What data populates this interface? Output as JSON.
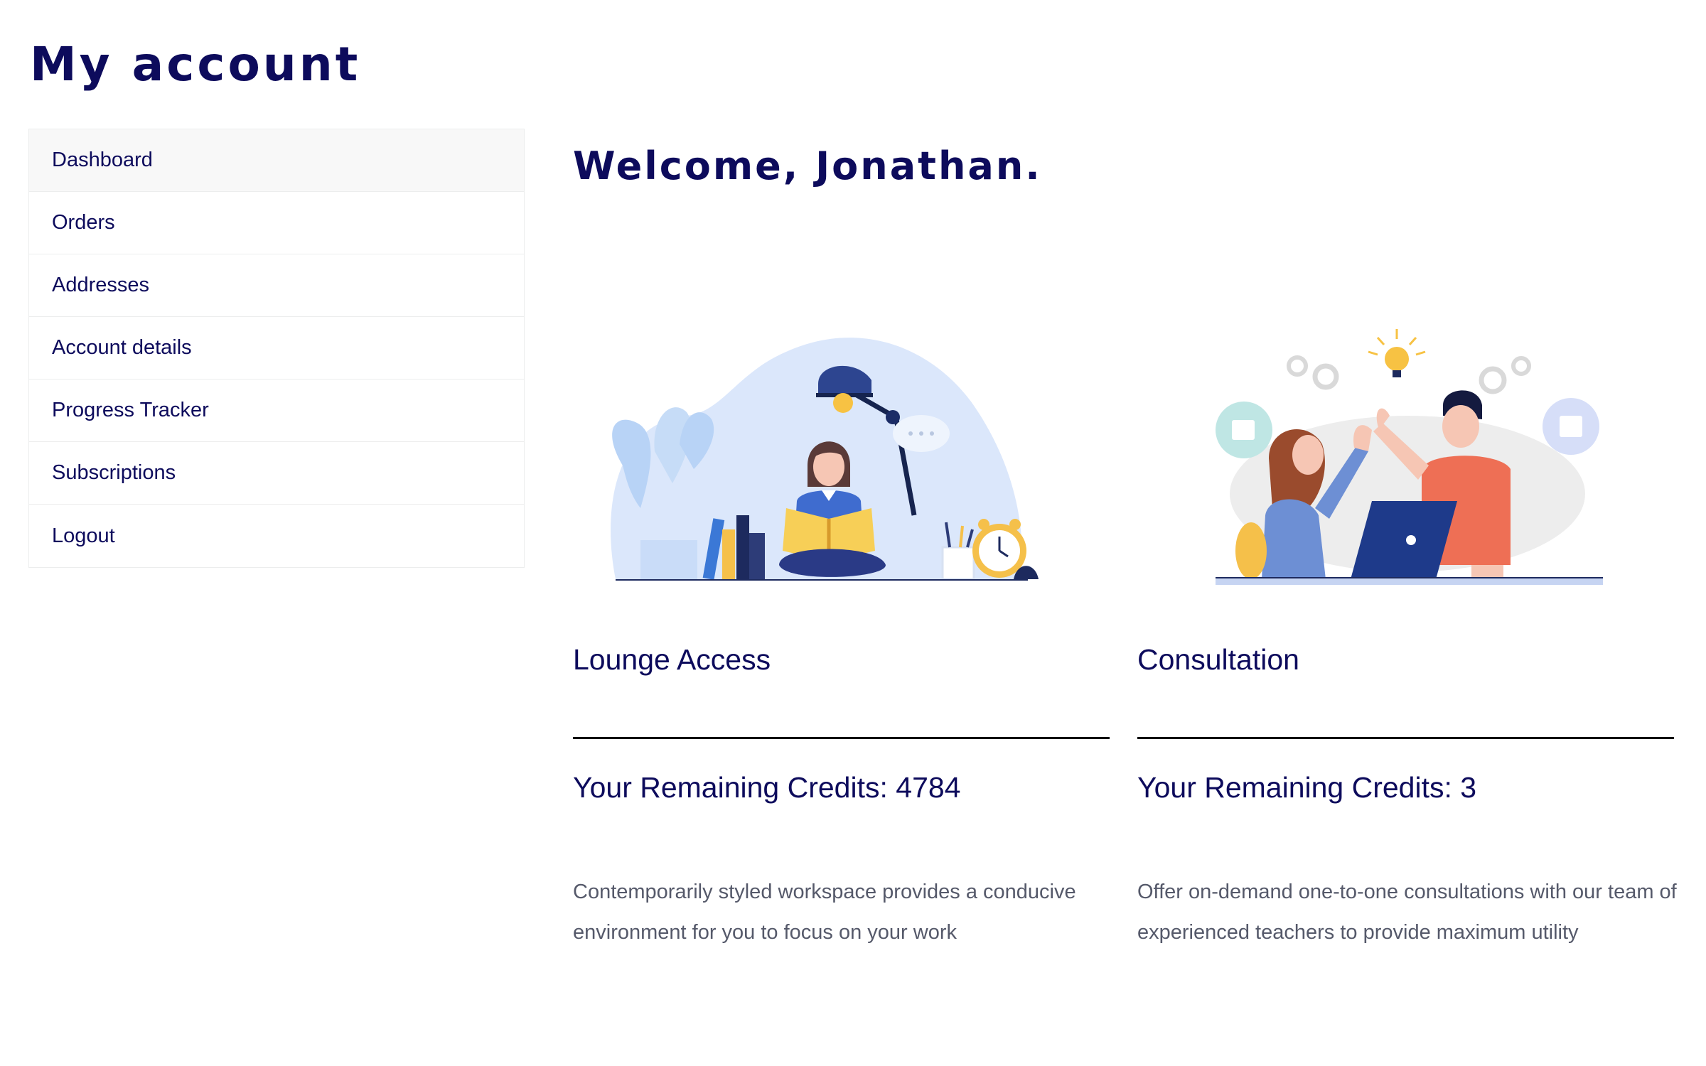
{
  "page": {
    "title": "My account"
  },
  "sidebar": {
    "items": [
      {
        "label": "Dashboard"
      },
      {
        "label": "Orders"
      },
      {
        "label": "Addresses"
      },
      {
        "label": "Account details"
      },
      {
        "label": "Progress Tracker"
      },
      {
        "label": "Subscriptions"
      },
      {
        "label": "Logout"
      }
    ]
  },
  "main": {
    "welcome": "Welcome, Jonathan.",
    "cards": [
      {
        "title": "Lounge Access",
        "credits_label": "Your Remaining Credits: ",
        "credits_value": "4784",
        "description": "Contemporarily styled workspace provides a conducive environment for you to focus on your work",
        "illustration": "reading-woman-illustration"
      },
      {
        "title": "Consultation",
        "credits_label": "Your Remaining Credits: ",
        "credits_value": "3",
        "description": "Offer on-demand one-to-one consultations with our team of experienced teachers to provide maximum utility",
        "illustration": "high-five-illustration"
      }
    ]
  },
  "colors": {
    "navy": "#0d0b5c",
    "text_gray": "#55596a",
    "border": "#eceded",
    "active_bg": "#f8f8f8"
  }
}
